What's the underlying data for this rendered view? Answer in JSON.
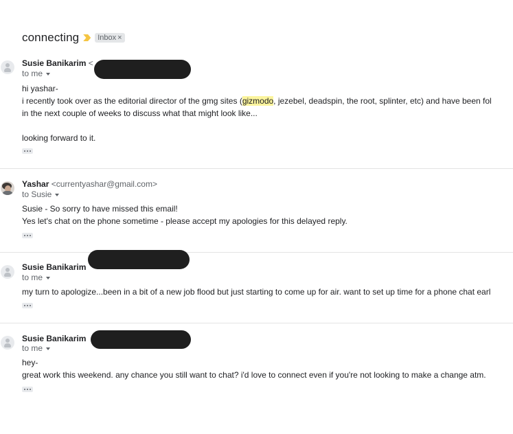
{
  "thread": {
    "subject": "connecting",
    "label": "Inbox",
    "label_remove": "×"
  },
  "messages": [
    {
      "sender_name": "Susie Banikarim",
      "sender_email": "<",
      "recipient": "to me",
      "lines": [
        "hi yashar-",
        "i recently took over as the editorial director of the gmg sites (",
        "gizmodo",
        ", jezebel, deadspin, the root, splinter, etc) and have been fol",
        "in the next couple of weeks to discuss what that might look like...",
        "looking forward to it."
      ]
    },
    {
      "sender_name": "Yashar",
      "sender_email": "<currentyashar@gmail.com>",
      "recipient": "to Susie",
      "lines": [
        "Susie - So sorry to have missed this email!",
        "Yes let's chat on the phone sometime - please accept my apologies for this delayed reply."
      ]
    },
    {
      "sender_name": "Susie Banikarim",
      "sender_email": "",
      "recipient": "to me",
      "lines": [
        "my turn to apologize...been in a bit of a new job flood but just starting to come up for air. want to set up time for a phone chat earl"
      ]
    },
    {
      "sender_name": "Susie Banikarim",
      "sender_email": "",
      "recipient": "to me",
      "lines": [
        "hey-",
        "great work this weekend. any chance you still want to chat? i'd love to connect even if you're not looking to make a change atm."
      ]
    }
  ],
  "icons": {
    "more": "ellipsis-icon",
    "avatar_default": "person-icon",
    "importance": "importance-marker-icon"
  },
  "colors": {
    "highlight": "#fbf49d",
    "redaction": "#1f1f1f",
    "importance": "#f5c542"
  }
}
